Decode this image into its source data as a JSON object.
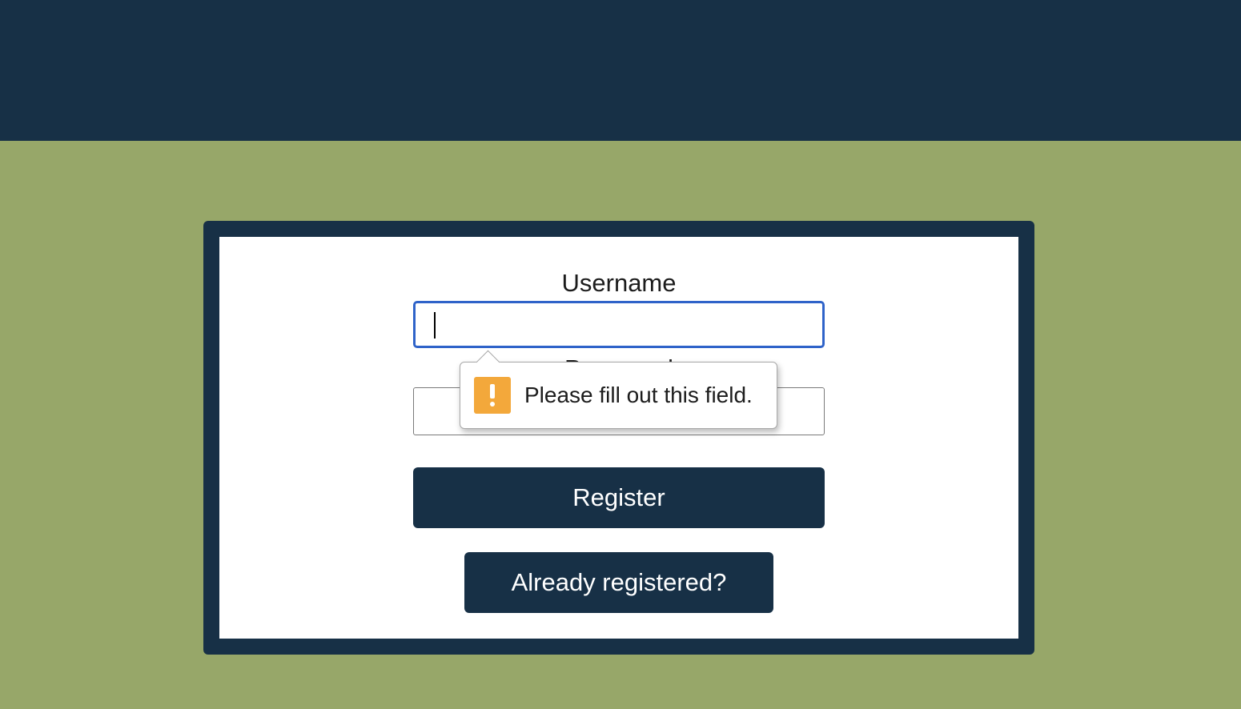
{
  "form": {
    "username_label": "Username",
    "username_value": "",
    "password_label": "Password",
    "password_value": "",
    "register_label": "Register",
    "already_registered_label": "Already registered?"
  },
  "validation": {
    "message": "Please fill out this field.",
    "icon": "warning-icon"
  },
  "colors": {
    "header_bg": "#173046",
    "page_bg": "#97a769",
    "button_bg": "#173046",
    "focus_border": "#2f63c9",
    "warning": "#f3a83b"
  }
}
